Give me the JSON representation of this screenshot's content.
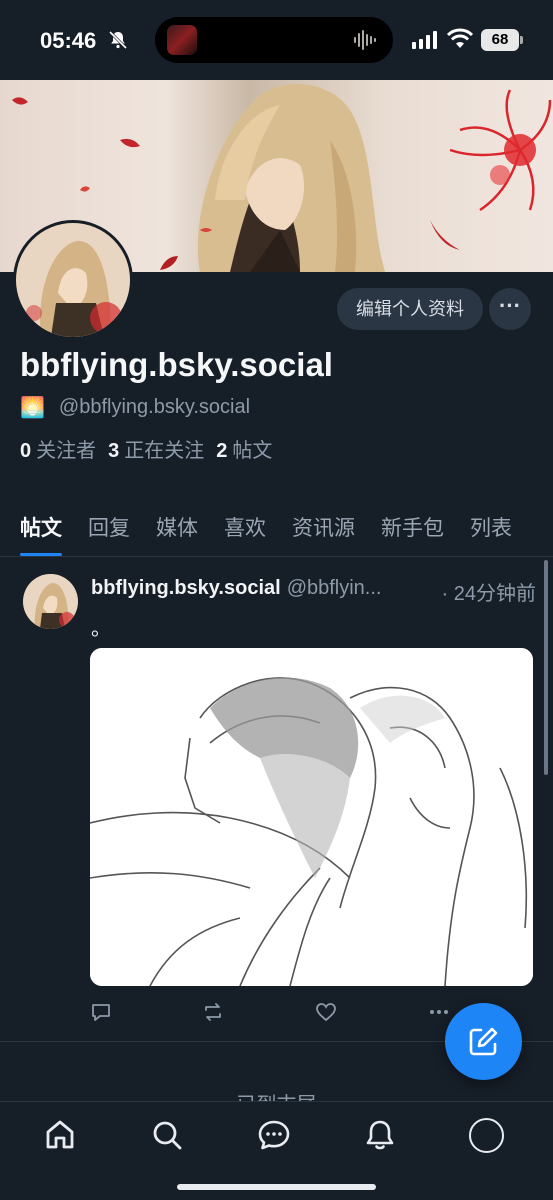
{
  "status_bar": {
    "time": "05:46",
    "battery": "68"
  },
  "profile": {
    "display_name": "bbflying.bsky.social",
    "handle_emoji": "🌅",
    "handle": "@bbflying.bsky.social",
    "edit_profile_label": "编辑个人资料",
    "more_label": "···",
    "stats": [
      {
        "count": "0",
        "label": "关注者"
      },
      {
        "count": "3",
        "label": "正在关注"
      },
      {
        "count": "2",
        "label": "帖文"
      }
    ]
  },
  "tabs": [
    {
      "label": "帖文",
      "active": true
    },
    {
      "label": "回复"
    },
    {
      "label": "媒体"
    },
    {
      "label": "喜欢"
    },
    {
      "label": "资讯源"
    },
    {
      "label": "新手包"
    },
    {
      "label": "列表"
    }
  ],
  "post": {
    "author": "bbflying.bsky.social",
    "handle": "@bbflyin...",
    "time": "· 24分钟前",
    "text": "。"
  },
  "feed_end_text": "已到末尾",
  "colors": {
    "background": "#161e27",
    "accent": "#1d85f5",
    "muted_text": "#8d9aa9",
    "button_bg": "#2a3644"
  },
  "icons": [
    "bell-slash-icon",
    "signal-icon",
    "wifi-icon",
    "comment-icon",
    "repost-icon",
    "heart-icon",
    "more-icon",
    "compose-icon",
    "home-icon",
    "search-icon",
    "chat-icon",
    "bell-icon"
  ]
}
